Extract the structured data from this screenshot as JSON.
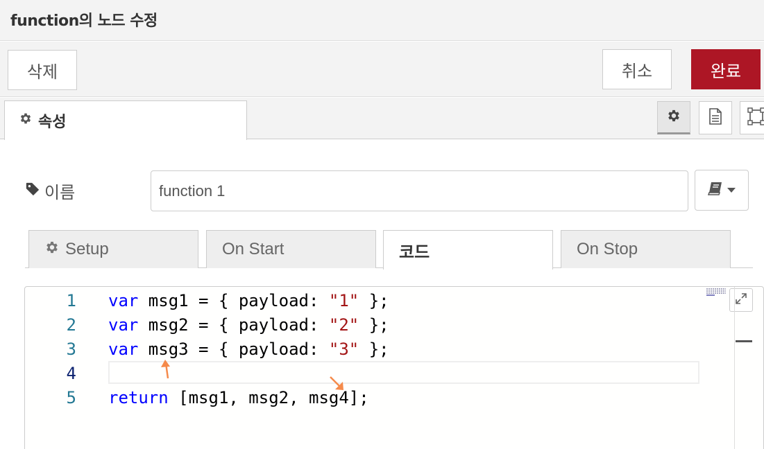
{
  "window": {
    "title": "function의 노드 수정"
  },
  "toolbar": {
    "delete_label": "삭제",
    "cancel_label": "취소",
    "done_label": "완료"
  },
  "tabs": {
    "properties_label": "속성"
  },
  "name_field": {
    "label": "이름",
    "value": "function 1"
  },
  "code_tabs": [
    {
      "label": "Setup"
    },
    {
      "label": "On Start"
    },
    {
      "label": "코드"
    },
    {
      "label": "On Stop"
    }
  ],
  "editor": {
    "lines": [
      {
        "num": "1",
        "kw": "var",
        "rest1": " msg1 = { payload: ",
        "str": "\"1\"",
        "rest2": " };"
      },
      {
        "num": "2",
        "kw": "var",
        "rest1": " msg2 = { payload: ",
        "str": "\"2\"",
        "rest2": " };"
      },
      {
        "num": "3",
        "kw": "var",
        "rest1": " msg3 = { payload: ",
        "str": "\"3\"",
        "rest2": " };"
      },
      {
        "num": "4",
        "kw": "",
        "rest1": "",
        "str": "",
        "rest2": ""
      },
      {
        "num": "5",
        "kw": "return",
        "rest1": " [msg1, msg2, msg4];",
        "str": "",
        "rest2": ""
      }
    ]
  },
  "colors": {
    "done_button": "#ad1625",
    "keyword": "#0000ff",
    "string": "#a31515",
    "line_number": "#237893",
    "annotation_arrow": "#f58a4b"
  },
  "icons": {
    "gear": "gear-icon",
    "tag": "tag-icon",
    "book": "book-icon",
    "document": "document-icon",
    "layout": "layout-icon",
    "expand": "expand-icon",
    "caret": "caret-down-icon"
  }
}
